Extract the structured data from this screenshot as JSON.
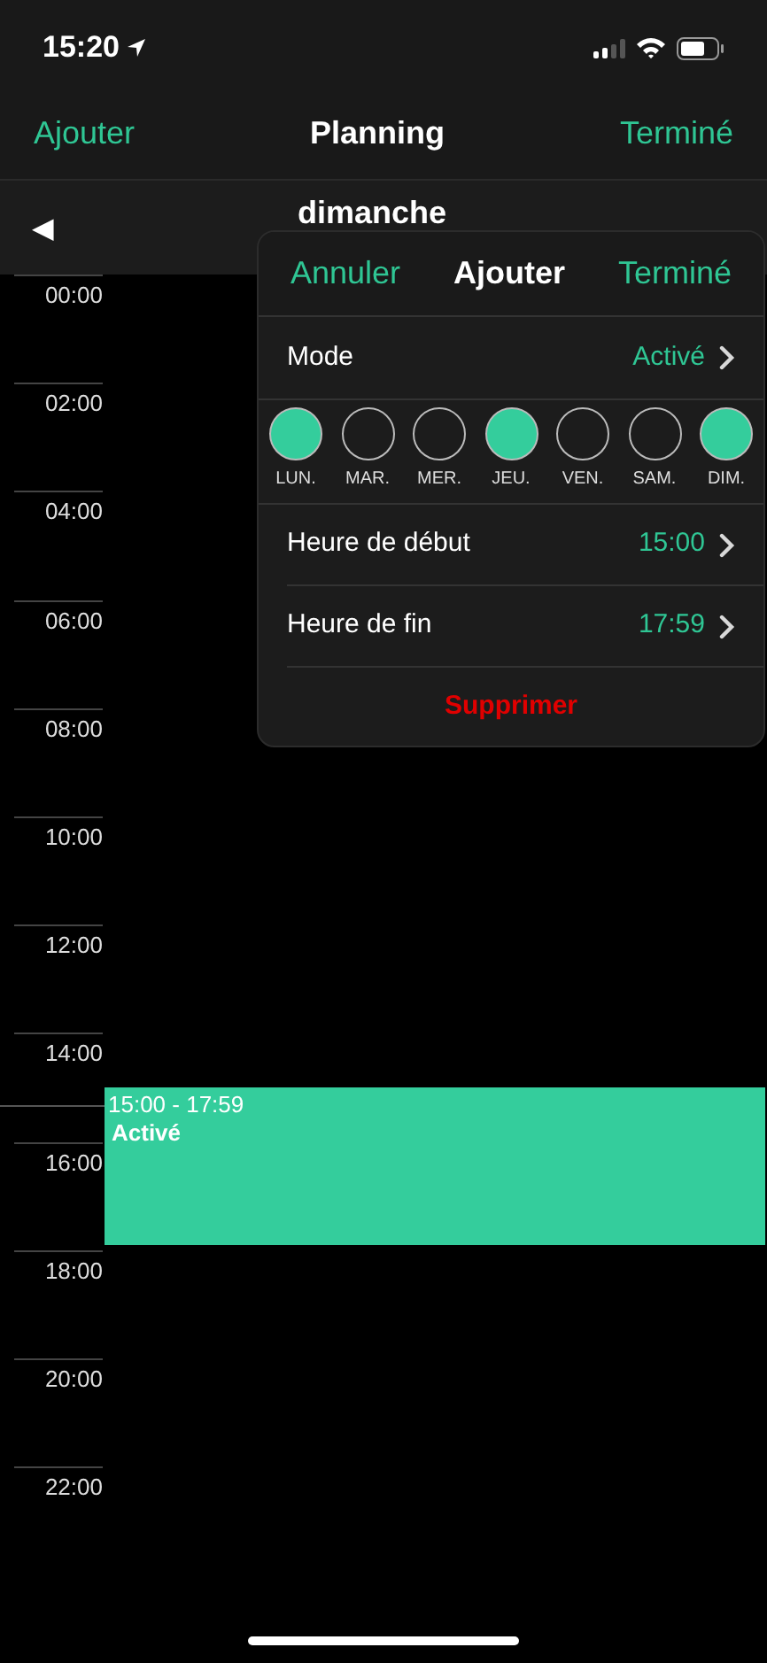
{
  "status_bar": {
    "time": "15:20"
  },
  "nav": {
    "left": "Ajouter",
    "title": "Planning",
    "right": "Terminé"
  },
  "day_header": {
    "prev": "◀",
    "day": "dimanche"
  },
  "timeline": {
    "hours": [
      "00:00",
      "02:00",
      "04:00",
      "06:00",
      "08:00",
      "10:00",
      "12:00",
      "14:00",
      "16:00",
      "18:00",
      "20:00",
      "22:00"
    ],
    "events": [
      {
        "time": "15:00 - 17:59",
        "label": "Activé"
      }
    ]
  },
  "popover": {
    "cancel": "Annuler",
    "title": "Ajouter",
    "done": "Terminé",
    "mode": {
      "label": "Mode",
      "value": "Activé"
    },
    "days": [
      {
        "label": "LUN.",
        "selected": true
      },
      {
        "label": "MAR.",
        "selected": false
      },
      {
        "label": "MER.",
        "selected": false
      },
      {
        "label": "JEU.",
        "selected": true
      },
      {
        "label": "VEN.",
        "selected": false
      },
      {
        "label": "SAM.",
        "selected": false
      },
      {
        "label": "DIM.",
        "selected": true
      }
    ],
    "times": [
      {
        "label": "Heure de début",
        "value": "15:00"
      },
      {
        "label": "Heure de fin",
        "value": "17:59"
      }
    ],
    "delete": "Supprimer"
  }
}
